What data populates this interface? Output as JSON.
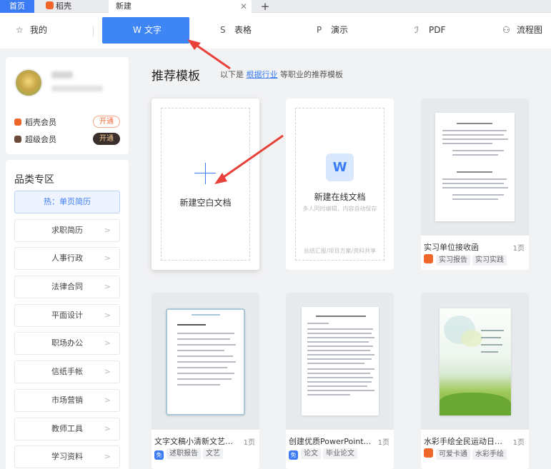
{
  "window_tabs": {
    "home": "首页",
    "daoke": "稻壳",
    "new_tab": "新建",
    "close": "✕",
    "add": "+"
  },
  "typebar": {
    "mine": "我的",
    "word": "文字",
    "table": "表格",
    "show": "演示",
    "pdf": "PDF",
    "flow": "流程图"
  },
  "profile": {
    "member1": "稻壳会员",
    "member1_btn": "开通",
    "member2": "超级会员",
    "member2_btn": "开通"
  },
  "categories": {
    "title": "品类专区",
    "items": [
      "热：单页简历",
      "求职简历",
      "人事行政",
      "法律合同",
      "平面设计",
      "职场办公",
      "信纸手帐",
      "市场营销",
      "教师工具",
      "学习资料"
    ]
  },
  "main": {
    "title": "推荐模板",
    "sub_prefix": "以下是",
    "sub_link": "根据行业",
    "sub_suffix": "等职业的推荐模板"
  },
  "blank_card": {
    "label": "新建空白文档"
  },
  "online_card": {
    "logo": "W",
    "label": "新建在线文档",
    "desc": "多人同时编辑，内容自动保存",
    "footer": "总结汇报/项目方案/资料共享"
  },
  "templates": [
    {
      "name": "实习单位接收函",
      "pages": "1页",
      "tags": [
        "实习报告",
        "实习实践"
      ],
      "badge": ""
    },
    {
      "name": "文字文稿小清新文艺总...",
      "pages": "1页",
      "tags": [
        "述职报告",
        "文艺"
      ],
      "badge": "免"
    },
    {
      "name": "创建优质PowerPoint...",
      "pages": "1页",
      "tags": [
        "论文",
        "毕业论文"
      ],
      "badge": "免"
    },
    {
      "name": "水彩手绘全民运动日信...",
      "pages": "1页",
      "tags": [
        "可爱卡通",
        "水彩手绘"
      ],
      "badge": ""
    }
  ],
  "colors": {
    "accent": "#3e86f6",
    "orange": "#f0662a",
    "arrow": "#e8413a"
  }
}
